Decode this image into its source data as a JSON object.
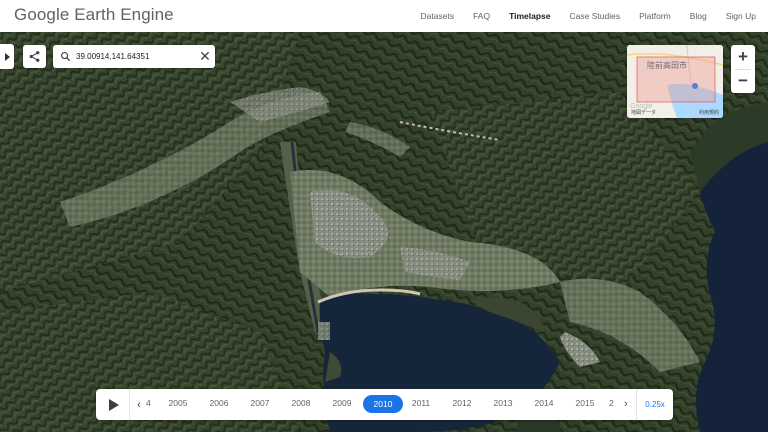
{
  "header": {
    "logo": "Google Earth Engine",
    "nav": [
      {
        "label": "Datasets",
        "active": false
      },
      {
        "label": "FAQ",
        "active": false
      },
      {
        "label": "Timelapse",
        "active": true
      },
      {
        "label": "Case Studies",
        "active": false
      },
      {
        "label": "Platform",
        "active": false
      },
      {
        "label": "Blog",
        "active": false
      },
      {
        "label": "Sign Up",
        "active": false
      }
    ]
  },
  "search": {
    "value": "39.00914,141.64351",
    "clear_icon": "close-icon"
  },
  "inset_map": {
    "place_label": "陸前高田市",
    "footer_left": "地図データ",
    "footer_right": "利用規約",
    "google_watermark": "Google"
  },
  "zoom": {
    "in": "+",
    "out": "−"
  },
  "timeline": {
    "left_partial_year": "4",
    "years": [
      "2005",
      "2006",
      "2007",
      "2008",
      "2009",
      "2010",
      "2011",
      "2012",
      "2013",
      "2014",
      "2015"
    ],
    "right_partial_year": "2",
    "selected_year": "2010",
    "speed": "0.25x",
    "prev_icon": "chevron-left-icon",
    "next_icon": "chevron-right-icon",
    "play_icon": "play-icon"
  },
  "colors": {
    "accent": "#1a73e8",
    "forest": "#2f3b22",
    "water": "#1a2a3a",
    "urban": "#8a8f86"
  }
}
